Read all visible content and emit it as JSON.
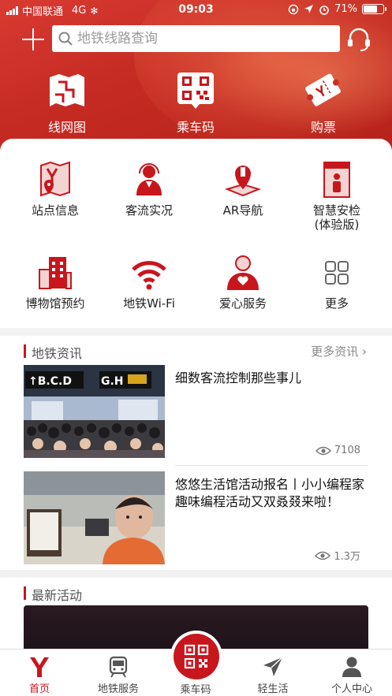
{
  "status_bar": {
    "carrier": "中国联通",
    "network": "4G",
    "time": "09:03",
    "battery": "71%",
    "battery_level": 0.71
  },
  "search": {
    "placeholder": "地铁线路查询"
  },
  "top_actions": [
    {
      "label": "线网图",
      "icon": "metro-map-icon"
    },
    {
      "label": "乘车码",
      "icon": "qr-code-icon"
    },
    {
      "label": "购票",
      "icon": "ticket-icon"
    }
  ],
  "services": [
    {
      "label": "站点信息",
      "icon": "station-info-icon"
    },
    {
      "label": "客流实况",
      "icon": "passenger-flow-icon"
    },
    {
      "label": "AR导航",
      "icon": "ar-navigation-icon"
    },
    {
      "label": "智慧安检",
      "sublabel": "(体验版)",
      "icon": "security-check-icon"
    },
    {
      "label": "博物馆预约",
      "icon": "museum-icon"
    },
    {
      "label": "地铁Wi-Fi",
      "icon": "wifi-icon"
    },
    {
      "label": "爱心服务",
      "icon": "care-service-icon"
    },
    {
      "label": "更多",
      "icon": "more-grid-icon"
    }
  ],
  "news_section": {
    "title": "地铁资讯",
    "more": "更多资讯",
    "items": [
      {
        "headline": "细数客流控制那些事儿",
        "views": "7108"
      },
      {
        "headline": "悠悠生活馆活动报名丨小小编程家趣味编程活动又双叒叕来啦！",
        "views": "1.3万"
      }
    ]
  },
  "activity_section": {
    "title": "最新活动"
  },
  "colors": {
    "brand_red": "#c8161d",
    "header_red": "#d0322a"
  },
  "tabbar": [
    {
      "label": "首页",
      "icon": "home-logo-icon",
      "active": true
    },
    {
      "label": "地铁服务",
      "icon": "train-icon"
    },
    {
      "label": "乘车码",
      "icon": "qr-code-icon"
    },
    {
      "label": "轻生活",
      "icon": "send-icon"
    },
    {
      "label": "个人中心",
      "icon": "user-icon"
    }
  ]
}
